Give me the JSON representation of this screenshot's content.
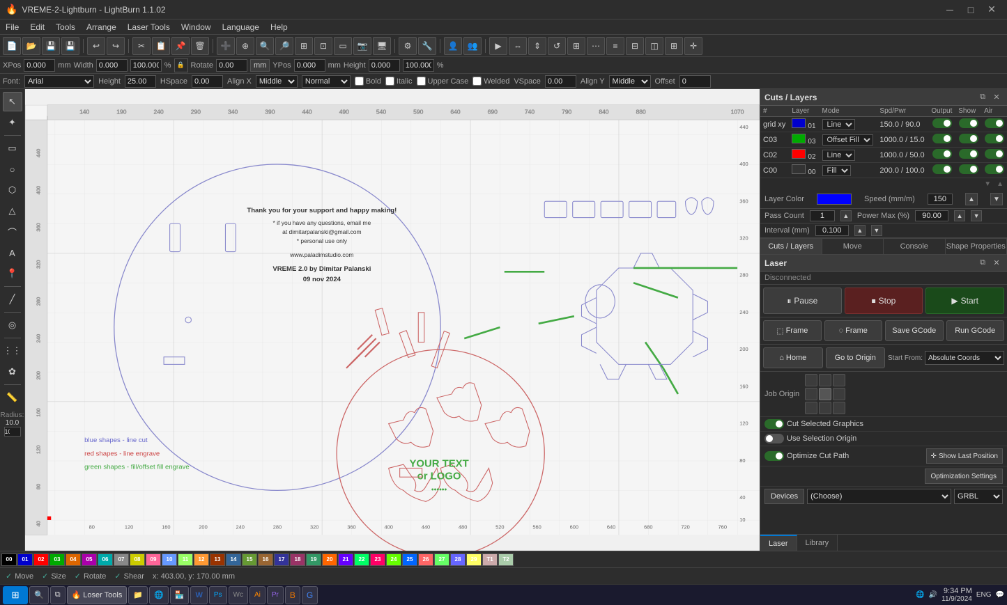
{
  "titlebar": {
    "title": "VREME-2-Lightburn - LightBurn 1.1.02",
    "icon": "lightburn-icon",
    "controls": [
      "minimize",
      "maximize",
      "close"
    ]
  },
  "menubar": {
    "items": [
      "File",
      "Edit",
      "Tools",
      "Arrange",
      "Laser Tools",
      "Window",
      "Language",
      "Help"
    ]
  },
  "propbar": {
    "xpos_label": "XPos",
    "ypos_label": "YPos",
    "xpos_value": "0.000",
    "ypos_value": "0.000",
    "unit": "mm",
    "width_label": "Width",
    "height_label": "Height",
    "width_value": "0.000",
    "height_value": "0.000",
    "width_pct": "100.000",
    "height_pct": "100.000",
    "rotate_value": "0.00",
    "unit_btn": "mm"
  },
  "propbar2": {
    "font_label": "Font:",
    "font_value": "Arial",
    "height_label": "Height",
    "height_value": "25.00",
    "hspace_label": "HSpace",
    "hspace_value": "0.00",
    "alignx_label": "Align X",
    "alignx_value": "Middle",
    "mode_value": "Normal",
    "bold_label": "Bold",
    "italic_label": "Italic",
    "upper_label": "Upper Case",
    "welded_label": "Welded",
    "vspace_label": "VSpace",
    "vspace_value": "0.00",
    "aligny_label": "Align Y",
    "aligny_value": "Middle",
    "offset_label": "Offset",
    "offset_value": "0"
  },
  "cuts_layers": {
    "title": "Cuts / Layers",
    "columns": [
      "#",
      "Layer",
      "Mode",
      "Spd/Pwr",
      "Output",
      "Show",
      "Air"
    ],
    "rows": [
      {
        "num": "grid xy",
        "color": "#0000ff",
        "color_code": "01",
        "mode": "Line",
        "spd_pwr": "150.0 / 90.0",
        "output": true,
        "show": true,
        "air": true
      },
      {
        "num": "C03",
        "color": "#00aa00",
        "color_code": "03",
        "mode": "Offset Fill",
        "spd_pwr": "1000.0 / 15.0",
        "output": true,
        "show": true,
        "air": true
      },
      {
        "num": "C02",
        "color": "#ff0000",
        "color_code": "02",
        "mode": "Line",
        "spd_pwr": "1000.0 / 50.0",
        "output": true,
        "show": true,
        "air": true
      },
      {
        "num": "C00",
        "color": "#000000",
        "color_code": "00",
        "mode": "Fill",
        "spd_pwr": "200.0 / 100.0",
        "output": true,
        "show": true,
        "air": true
      }
    ],
    "layer_color_label": "Layer Color",
    "speed_label": "Speed (mm/m)",
    "speed_value": "150",
    "pass_count_label": "Pass Count",
    "pass_value": "1",
    "power_max_label": "Power Max (%)",
    "power_value": "90.00",
    "interval_label": "Interval (mm)",
    "interval_value": "0.100"
  },
  "panel_tabs": {
    "tabs": [
      "Cuts / Layers",
      "Move",
      "Console",
      "Shape Properties"
    ]
  },
  "laser": {
    "title": "Laser",
    "status": "Disconnected",
    "pause_label": "Pause",
    "stop_label": "Stop",
    "start_label": "Start",
    "frame_label": "Frame",
    "frame2_label": "Frame",
    "save_gcode_label": "Save GCode",
    "run_gcode_label": "Run GCode",
    "home_label": "Home",
    "go_to_origin_label": "Go to Origin",
    "start_from_label": "Start From:",
    "start_from_value": "Absolute Coords",
    "job_origin_label": "Job Origin",
    "cut_selected_label": "Cut Selected Graphics",
    "use_selection_label": "Use Selection Origin",
    "optimize_cut_label": "Optimize Cut Path",
    "show_last_position_label": "Show Last Position",
    "optimization_settings_label": "Optimization Settings",
    "devices_label": "Devices",
    "device_value": "(Choose)",
    "controller_value": "GRBL"
  },
  "bottom_tabs": {
    "tabs": [
      "Laser",
      "Library"
    ]
  },
  "palette_colors": [
    {
      "id": "00",
      "color": "#000000"
    },
    {
      "id": "01",
      "color": "#0000cc"
    },
    {
      "id": "02",
      "color": "#ff0000"
    },
    {
      "id": "03",
      "color": "#00aa00"
    },
    {
      "id": "04",
      "color": "#dd6600"
    },
    {
      "id": "05",
      "color": "#aa00aa"
    },
    {
      "id": "06",
      "color": "#00aaaa"
    },
    {
      "id": "07",
      "color": "#888888"
    },
    {
      "id": "08",
      "color": "#cccc00"
    },
    {
      "id": "09",
      "color": "#ff6699"
    },
    {
      "id": "10",
      "color": "#6699ff"
    },
    {
      "id": "11",
      "color": "#99ff66"
    },
    {
      "id": "12",
      "color": "#ff9933"
    },
    {
      "id": "13",
      "color": "#993300"
    },
    {
      "id": "14",
      "color": "#336699"
    },
    {
      "id": "15",
      "color": "#669933"
    },
    {
      "id": "16",
      "color": "#996633"
    },
    {
      "id": "17",
      "color": "#333399"
    },
    {
      "id": "18",
      "color": "#993366"
    },
    {
      "id": "19",
      "color": "#339966"
    },
    {
      "id": "20",
      "color": "#ff6600"
    },
    {
      "id": "21",
      "color": "#6600ff"
    },
    {
      "id": "22",
      "color": "#00ff66"
    },
    {
      "id": "23",
      "color": "#ff0066"
    },
    {
      "id": "24",
      "color": "#66ff00"
    },
    {
      "id": "25",
      "color": "#0066ff"
    },
    {
      "id": "26",
      "color": "#ff6666"
    },
    {
      "id": "27",
      "color": "#66ff66"
    },
    {
      "id": "28",
      "color": "#6666ff"
    },
    {
      "id": "29",
      "color": "#ffff66"
    },
    {
      "id": "T1",
      "color": "#ccaaaa"
    },
    {
      "id": "T2",
      "color": "#aaccaa"
    }
  ],
  "statusbar": {
    "move_label": "Move",
    "size_label": "Size",
    "rotate_label": "Rotate",
    "shear_label": "Shear",
    "coords": "x: 403.00, y: 170.00 mm"
  },
  "canvas": {
    "text_lines": [
      "Thank you for your support and happy making!",
      "",
      "* if you have any questions, email me",
      "at dimitarpalanski@gmail.com",
      "* personal use only",
      "",
      "www.paladimstudio.com",
      "",
      "VREME 2.0 by Dimitar Palanski",
      "09 nov 2024"
    ],
    "legend": [
      {
        "text": "blue shapes - line cut",
        "color": "#6666cc"
      },
      {
        "text": "red shapes - line engrave",
        "color": "#cc4444"
      },
      {
        "text": "green shapes - fill/offset fill engrave",
        "color": "#44aa44"
      }
    ],
    "your_text": "YOUR TEXT\nor LOGO",
    "your_text_color": "#44aa44"
  },
  "taskbar": {
    "start_icon": "⊞",
    "apps": [
      {
        "name": "search",
        "icon": "🔍"
      },
      {
        "name": "task-view",
        "icon": "⧉"
      },
      {
        "name": "lightburn",
        "icon": "LB",
        "label": "Loser Tools"
      },
      {
        "name": "file-manager",
        "icon": "📁"
      },
      {
        "name": "browser",
        "icon": "🌐"
      },
      {
        "name": "windows-store",
        "icon": "🏪"
      },
      {
        "name": "word",
        "icon": "W"
      },
      {
        "name": "photoshop",
        "icon": "Ps"
      },
      {
        "name": "wacom",
        "icon": "Wa"
      },
      {
        "name": "illustrator",
        "icon": "Ai"
      },
      {
        "name": "premiere",
        "icon": "Pr"
      },
      {
        "name": "blender",
        "icon": "B"
      },
      {
        "name": "chrome",
        "icon": "G"
      }
    ],
    "time": "9:34 PM",
    "date": "11/9/2024",
    "lang": "ENG"
  }
}
